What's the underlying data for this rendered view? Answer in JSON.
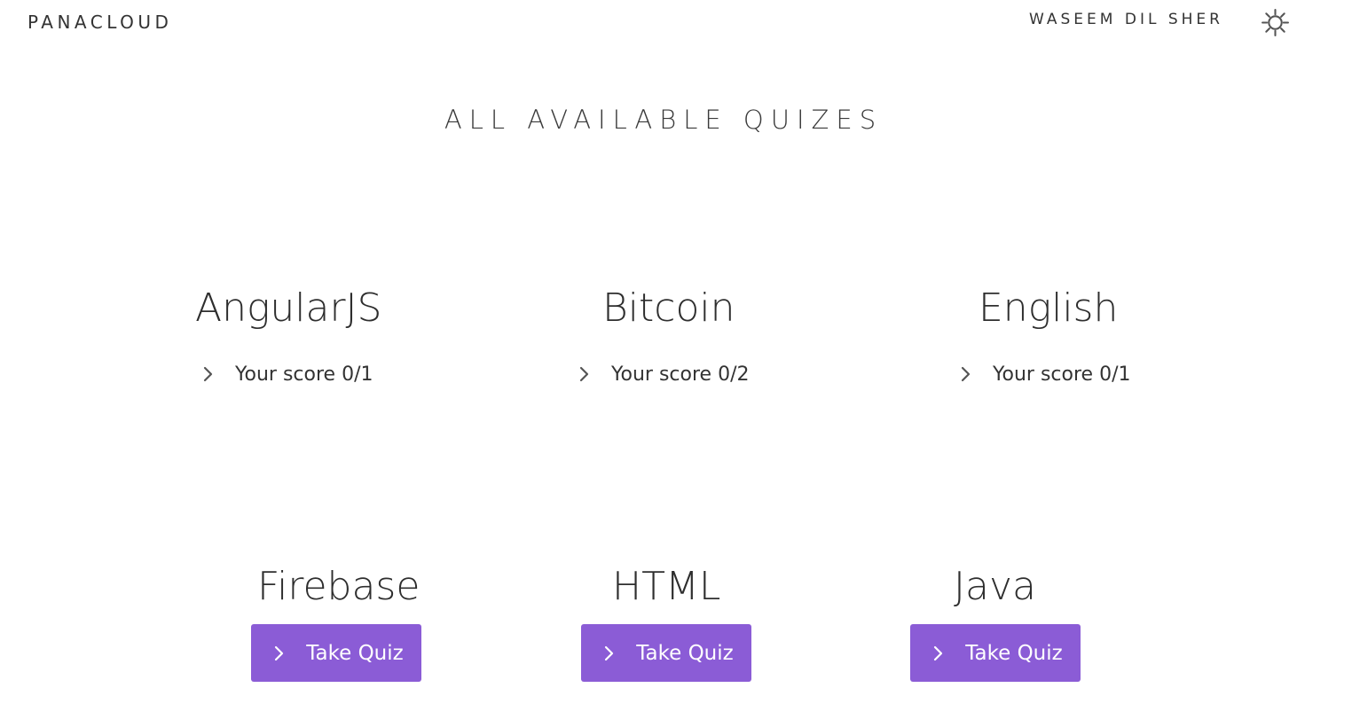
{
  "header": {
    "brand": "PANACLOUD",
    "user_name": "WASEEM DIL SHER",
    "settings_icon": "gear-icon"
  },
  "main": {
    "title": "ALL AVAILABLE QUIZES",
    "completed_quizzes": [
      {
        "name": "AngularJS",
        "score_text": "Your score 0/1"
      },
      {
        "name": "Bitcoin",
        "score_text": "Your score 0/2"
      },
      {
        "name": "English",
        "score_text": "Your score 0/1"
      }
    ],
    "available_quizzes": [
      {
        "name": "Firebase",
        "button_label": "Take Quiz"
      },
      {
        "name": "HTML",
        "button_label": "Take Quiz"
      },
      {
        "name": "Java",
        "button_label": "Take Quiz"
      }
    ]
  },
  "colors": {
    "accent": "#8b5cd6",
    "text": "#333333",
    "background": "#ffffff"
  }
}
